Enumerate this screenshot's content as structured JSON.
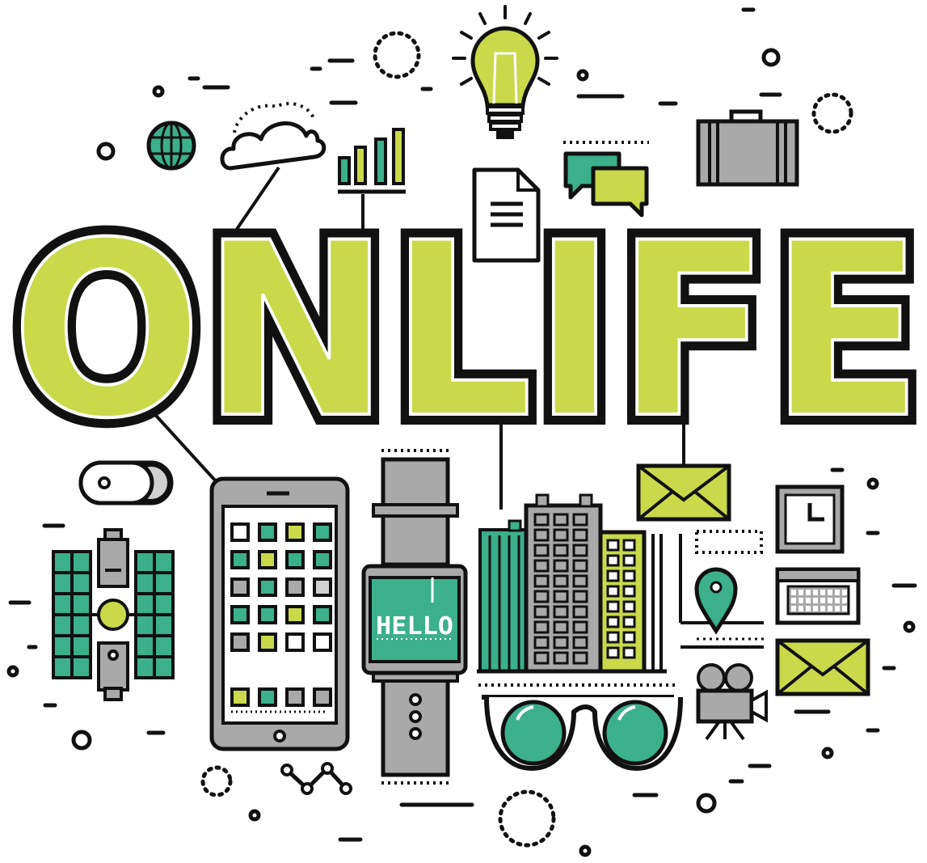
{
  "headline": "ONLIFE",
  "watch_screen_text": "HELLO",
  "colors": {
    "ink": "#111111",
    "lime": "#c9d94a",
    "teal": "#3bb08a",
    "gray": "#a9a9a9",
    "light_gray": "#d0d0d0",
    "white": "#ffffff"
  },
  "icons": [
    "light-bulb-icon",
    "globe-icon",
    "cloud-icon",
    "bar-chart-icon",
    "document-icon",
    "chat-bubbles-icon",
    "briefcase-icon",
    "toggle-switch-icon",
    "satellite-icon",
    "tablet-icon",
    "smartwatch-icon",
    "city-buildings-icon",
    "envelope-icon",
    "clock-icon",
    "calendar-icon",
    "map-pin-icon",
    "video-camera-icon",
    "glasses-icon"
  ]
}
